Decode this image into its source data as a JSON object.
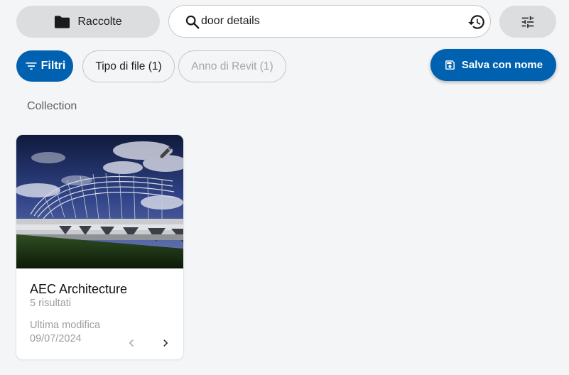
{
  "toolbar": {
    "collections_label": "Raccolte",
    "search_value": "door details",
    "search_placeholder": ""
  },
  "filters": {
    "filters_label": "Filtri",
    "file_type_chip": "Tipo di file (1)",
    "revit_year_chip": "Anno di Revit (1)",
    "save_as_label": "Salva con nome"
  },
  "section": {
    "label": "Collection"
  },
  "card": {
    "title": "AEC Architecture",
    "count": "5 risultati",
    "modified_label": "Ultima modifica",
    "modified_date": "09/07/2024"
  },
  "colors": {
    "accent": "#0061b0",
    "background": "#f4f5f7",
    "pill_gray": "#dcdddf"
  },
  "icons": {
    "collections": "folder-icon",
    "search": "search-icon",
    "history": "history-icon",
    "settings": "tune-icon",
    "filters": "filter-icon",
    "save": "save-icon",
    "edit": "pencil-icon",
    "prev": "chevron-left-icon",
    "next": "chevron-right-icon"
  }
}
